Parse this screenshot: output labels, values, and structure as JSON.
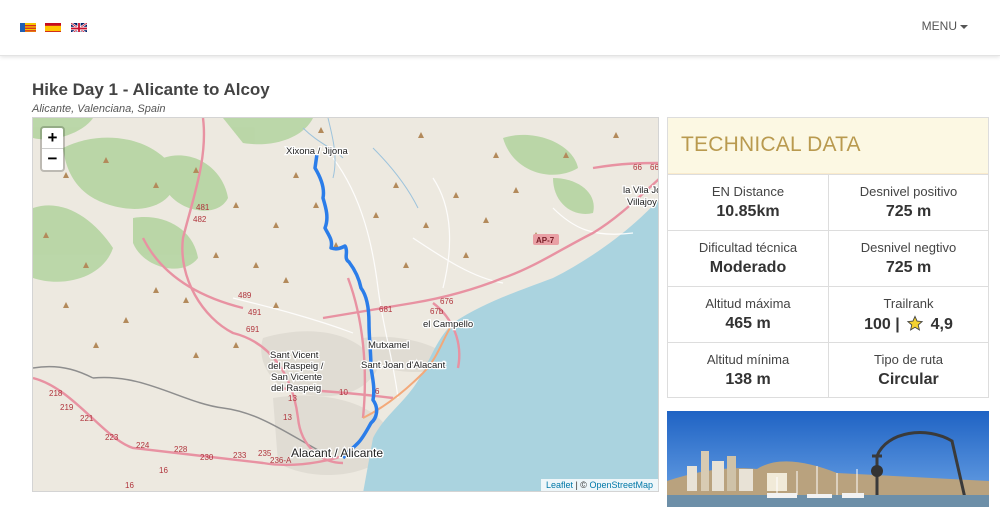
{
  "nav": {
    "flags": [
      {
        "name": "valencian-flag",
        "colors": [
          "#f6c400",
          "#d52b1e"
        ]
      },
      {
        "name": "spanish-flag",
        "colors": [
          "#c60b1e",
          "#ffc400"
        ]
      },
      {
        "name": "english-flag",
        "colors": [
          "#012169",
          "#ffffff",
          "#c8102e"
        ]
      }
    ],
    "menu_label": "MENU"
  },
  "page": {
    "title": "Hike Day 1 - Alicante to Alcoy",
    "subtitle": "Alicante, Valenciana, Spain"
  },
  "map": {
    "zoom_in": "+",
    "zoom_out": "−",
    "attribution_leaflet": "Leaflet",
    "attribution_sep": " | © ",
    "attribution_osm": "OpenStreetMap",
    "places": {
      "xixona": "Xixona / Jijona",
      "la_vila_joiosa": "la Vila Jo",
      "villajoyosa": "Villajoy",
      "el_campello": "el Campello",
      "mutxamel": "Mutxamel",
      "sant_joan": "Sant Joan d'Alacant",
      "sant_vicent": "Sant Vicent",
      "del_raspeig": "del Raspeig /",
      "san_vicente": "San Vicente",
      "del_raspeig2": "del Raspeig",
      "alacant": "Alacant / Alicante"
    },
    "road_labels": [
      "66",
      "66",
      "AP-7",
      "481",
      "482",
      "489",
      "491",
      "691",
      "681",
      "676",
      "67b",
      "10",
      "6",
      "13",
      "13",
      "218",
      "219",
      "221",
      "223",
      "224",
      "228",
      "230",
      "233",
      "235",
      "236-A",
      "16",
      "16"
    ],
    "colors": {
      "route": "#2b7de9",
      "sea": "#aad3df",
      "forest": "#add19e",
      "road": "#e892a2"
    }
  },
  "tech": {
    "heading": "TECHNICAL DATA",
    "items": [
      {
        "label": "EN Distance",
        "value": "10.85km"
      },
      {
        "label": "Desnivel positivo",
        "value": "725 m"
      },
      {
        "label": "Dificultad técnica",
        "value": "Moderado"
      },
      {
        "label": "Desnivel negtivo",
        "value": "725 m"
      },
      {
        "label": "Altitud máxima",
        "value": "465 m"
      },
      {
        "label": "Trailrank",
        "value": "100 |",
        "value_suffix": "4,9",
        "icon": "star-icon"
      },
      {
        "label": "Altitud mínima",
        "value": "138 m"
      },
      {
        "label": "Tipo de ruta",
        "value": "Circular"
      }
    ]
  }
}
